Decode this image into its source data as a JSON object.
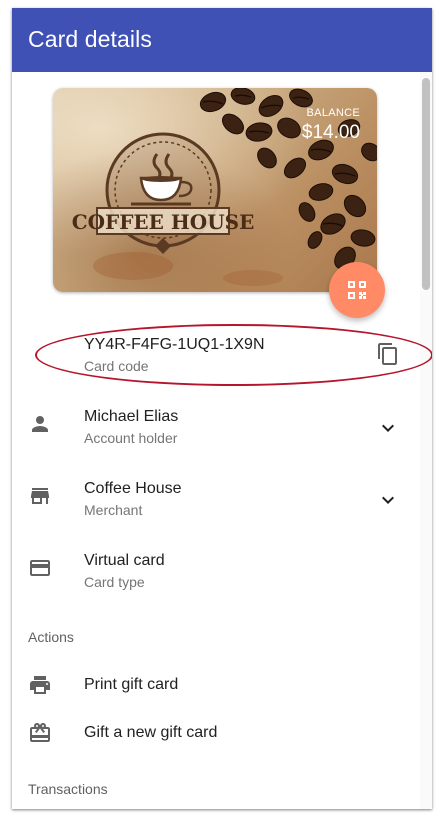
{
  "appbar": {
    "title": "Card details"
  },
  "card": {
    "brand_logo_text": "COFFEE HOUSE",
    "balance_label": "BALANCE",
    "balance_value": "$14.00"
  },
  "code_row": {
    "code": "YY4R-F4FG-1UQ1-1X9N",
    "label": "Card code"
  },
  "holder_row": {
    "name": "Michael Elias",
    "label": "Account holder"
  },
  "merchant_row": {
    "name": "Coffee House",
    "label": "Merchant"
  },
  "type_row": {
    "name": "Virtual card",
    "label": "Card type"
  },
  "actions": {
    "header": "Actions",
    "print": "Print gift card",
    "gift": "Gift a new gift card"
  },
  "transactions": {
    "header": "Transactions"
  },
  "colors": {
    "appbar": "#3f51b5",
    "fab": "#ff8a65",
    "highlight": "#b5162c"
  },
  "icons": {
    "qr": "qr-code-icon",
    "copy": "copy-icon",
    "person": "person-icon",
    "store": "store-icon",
    "card": "credit-card-icon",
    "print": "print-icon",
    "gift": "gift-card-icon",
    "expand": "chevron-down-icon"
  }
}
